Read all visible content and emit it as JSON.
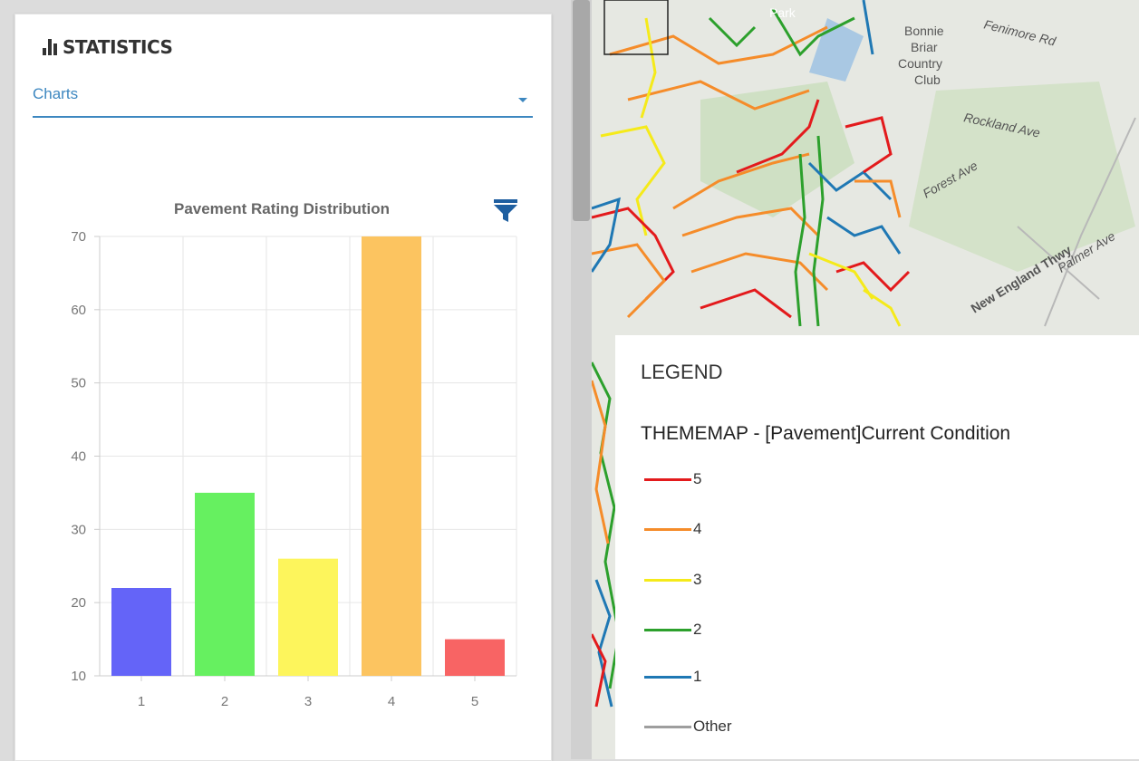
{
  "panel": {
    "title": "STATISTICS",
    "select_value": "Charts"
  },
  "chart_data": {
    "type": "bar",
    "title": "Pavement Rating Distribution",
    "categories": [
      "1",
      "2",
      "3",
      "4",
      "5"
    ],
    "values": [
      22,
      35,
      26,
      70,
      15
    ],
    "colors": [
      "#6464f8",
      "#66f060",
      "#fdf55c",
      "#fcc460",
      "#f86464"
    ],
    "ylim": [
      10,
      70
    ],
    "yticks": [
      10,
      20,
      30,
      40,
      50,
      60,
      70
    ],
    "grid": true
  },
  "map": {
    "labels": [
      "Park",
      "Bonnie",
      "Briar",
      "Country",
      "Club",
      "Fenimore Rd",
      "Rockland Ave",
      "Forest Ave",
      "New England Thwy",
      "Palmer Ave"
    ]
  },
  "legend": {
    "title": "LEGEND",
    "subtitle": "THEMEMAP - [Pavement]Current Condition",
    "items": [
      {
        "label": "5",
        "color": "#e31a1c"
      },
      {
        "label": "4",
        "color": "#f58c2a"
      },
      {
        "label": "3",
        "color": "#f5ea1a"
      },
      {
        "label": "2",
        "color": "#2ca02c"
      },
      {
        "label": "1",
        "color": "#1f78b4"
      },
      {
        "label": "Other",
        "color": "#9e9e9e"
      }
    ]
  }
}
